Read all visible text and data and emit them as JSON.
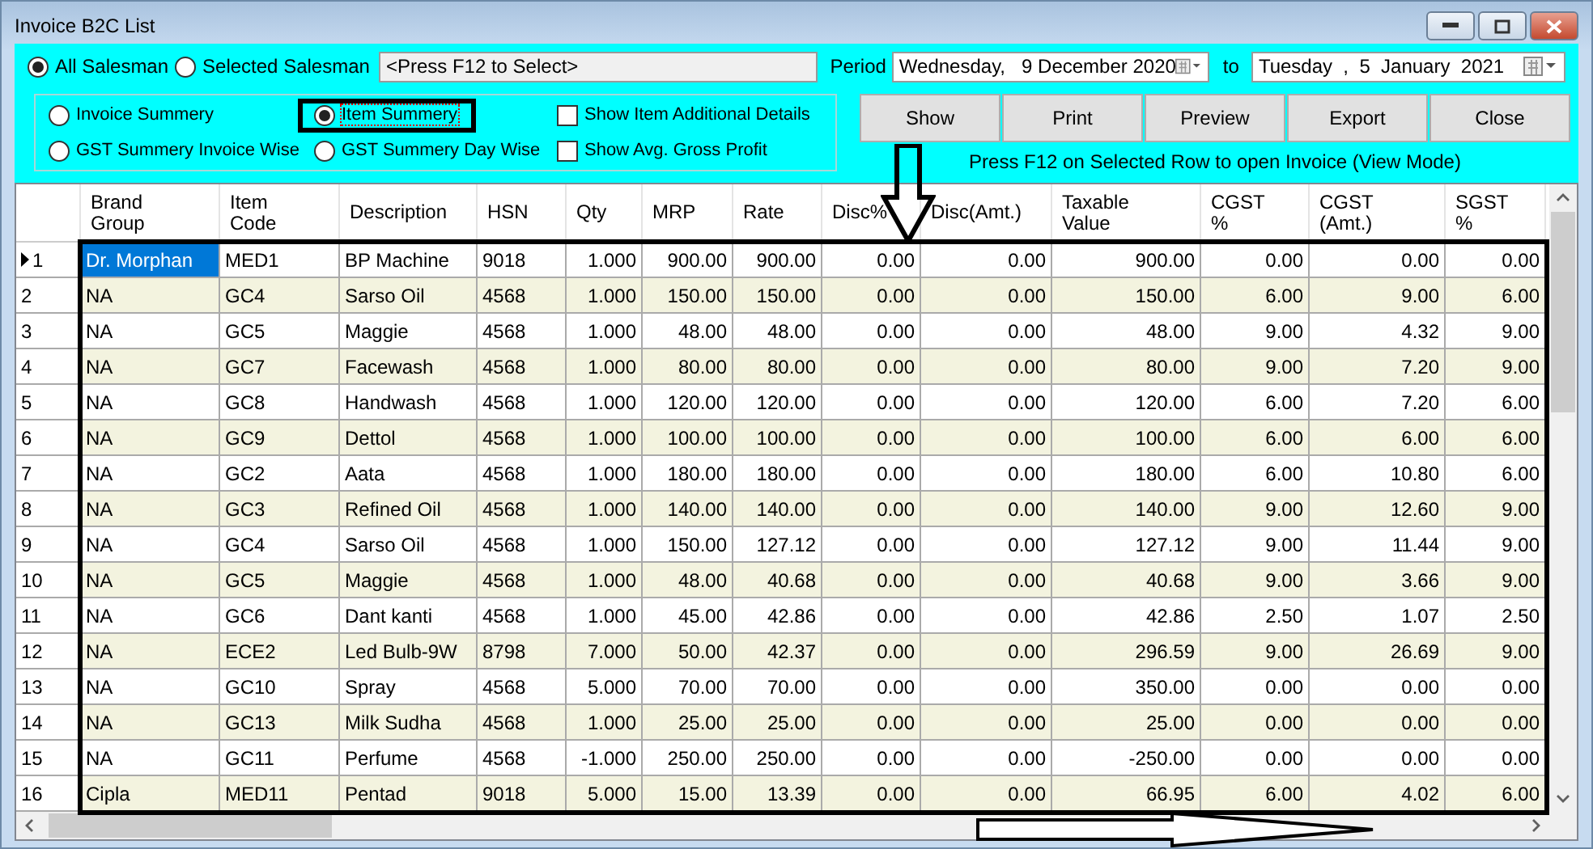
{
  "window": {
    "title": "Invoice B2C List"
  },
  "salesman_filter": [
    {
      "label": "All Salesman",
      "selected": true
    },
    {
      "label": "Selected Salesman",
      "selected": false
    }
  ],
  "salesman_field": {
    "value": "<Press F12 to Select>"
  },
  "period": {
    "label": "Period",
    "from": "Wednesday,   9 December 2020",
    "to_label": "to",
    "to": "Tuesday  ,  5  January  2021"
  },
  "report_types": [
    {
      "label": "Invoice Summery",
      "selected": false,
      "highlighted": false
    },
    {
      "label": "Item Summery",
      "selected": true,
      "highlighted": true
    },
    {
      "label": "GST Summery Invoice Wise",
      "selected": false,
      "highlighted": false
    },
    {
      "label": "GST Summery Day Wise",
      "selected": false,
      "highlighted": false
    }
  ],
  "options": [
    {
      "label": "Show Item Additional Details",
      "checked": false
    },
    {
      "label": "Show Avg. Gross Profit",
      "checked": false
    }
  ],
  "buttons": [
    "Show",
    "Print",
    "Preview",
    "Export",
    "Close"
  ],
  "hint": "Press F12 on Selected Row to open Invoice (View Mode)",
  "table": {
    "columns": [
      "Brand\nGroup",
      "Item\nCode",
      "Description",
      "HSN",
      "Qty",
      "MRP",
      "Rate",
      "Disc%",
      "Disc(Amt.)",
      "Taxable\nValue",
      "CGST\n%",
      "CGST\n(Amt.)",
      "SGST\n%"
    ],
    "rows": [
      {
        "number": "1",
        "selected": true,
        "cells": [
          "Dr. Morphan",
          "MED1",
          "BP Machine",
          "9018",
          "1.000",
          "900.00",
          "900.00",
          "0.00",
          "0.00",
          "900.00",
          "0.00",
          "0.00",
          "0.00"
        ]
      },
      {
        "number": "2",
        "selected": false,
        "cells": [
          "NA",
          "GC4",
          "Sarso Oil",
          "4568",
          "1.000",
          "150.00",
          "150.00",
          "0.00",
          "0.00",
          "150.00",
          "6.00",
          "9.00",
          "6.00"
        ]
      },
      {
        "number": "3",
        "selected": false,
        "cells": [
          "NA",
          "GC5",
          "Maggie",
          "4568",
          "1.000",
          "48.00",
          "48.00",
          "0.00",
          "0.00",
          "48.00",
          "9.00",
          "4.32",
          "9.00"
        ]
      },
      {
        "number": "4",
        "selected": false,
        "cells": [
          "NA",
          "GC7",
          "Facewash",
          "4568",
          "1.000",
          "80.00",
          "80.00",
          "0.00",
          "0.00",
          "80.00",
          "9.00",
          "7.20",
          "9.00"
        ]
      },
      {
        "number": "5",
        "selected": false,
        "cells": [
          "NA",
          "GC8",
          "Handwash",
          "4568",
          "1.000",
          "120.00",
          "120.00",
          "0.00",
          "0.00",
          "120.00",
          "6.00",
          "7.20",
          "6.00"
        ]
      },
      {
        "number": "6",
        "selected": false,
        "cells": [
          "NA",
          "GC9",
          "Dettol",
          "4568",
          "1.000",
          "100.00",
          "100.00",
          "0.00",
          "0.00",
          "100.00",
          "6.00",
          "6.00",
          "6.00"
        ]
      },
      {
        "number": "7",
        "selected": false,
        "cells": [
          "NA",
          "GC2",
          "Aata",
          "4568",
          "1.000",
          "180.00",
          "180.00",
          "0.00",
          "0.00",
          "180.00",
          "6.00",
          "10.80",
          "6.00"
        ]
      },
      {
        "number": "8",
        "selected": false,
        "cells": [
          "NA",
          "GC3",
          "Refined Oil",
          "4568",
          "1.000",
          "140.00",
          "140.00",
          "0.00",
          "0.00",
          "140.00",
          "9.00",
          "12.60",
          "9.00"
        ]
      },
      {
        "number": "9",
        "selected": false,
        "cells": [
          "NA",
          "GC4",
          "Sarso Oil",
          "4568",
          "1.000",
          "150.00",
          "127.12",
          "0.00",
          "0.00",
          "127.12",
          "9.00",
          "11.44",
          "9.00"
        ]
      },
      {
        "number": "10",
        "selected": false,
        "cells": [
          "NA",
          "GC5",
          "Maggie",
          "4568",
          "1.000",
          "48.00",
          "40.68",
          "0.00",
          "0.00",
          "40.68",
          "9.00",
          "3.66",
          "9.00"
        ]
      },
      {
        "number": "11",
        "selected": false,
        "cells": [
          "NA",
          "GC6",
          "Dant kanti",
          "4568",
          "1.000",
          "45.00",
          "42.86",
          "0.00",
          "0.00",
          "42.86",
          "2.50",
          "1.07",
          "2.50"
        ]
      },
      {
        "number": "12",
        "selected": false,
        "cells": [
          "NA",
          "ECE2",
          "Led Bulb-9W",
          "8798",
          "7.000",
          "50.00",
          "42.37",
          "0.00",
          "0.00",
          "296.59",
          "9.00",
          "26.69",
          "9.00"
        ]
      },
      {
        "number": "13",
        "selected": false,
        "cells": [
          "NA",
          "GC10",
          "Spray",
          "4568",
          "5.000",
          "70.00",
          "70.00",
          "0.00",
          "0.00",
          "350.00",
          "0.00",
          "0.00",
          "0.00"
        ]
      },
      {
        "number": "14",
        "selected": false,
        "cells": [
          "NA",
          "GC13",
          "Milk Sudha",
          "4568",
          "1.000",
          "25.00",
          "25.00",
          "0.00",
          "0.00",
          "25.00",
          "0.00",
          "0.00",
          "0.00"
        ]
      },
      {
        "number": "15",
        "selected": false,
        "cells": [
          "NA",
          "GC11",
          "Perfume",
          "4568",
          "-1.000",
          "250.00",
          "250.00",
          "0.00",
          "0.00",
          "-250.00",
          "0.00",
          "0.00",
          "0.00"
        ]
      },
      {
        "number": "16",
        "selected": false,
        "cells": [
          "Cipla",
          "MED11",
          "Pentad",
          "9018",
          "5.000",
          "15.00",
          "13.39",
          "0.00",
          "0.00",
          "66.95",
          "6.00",
          "4.02",
          "6.00"
        ]
      }
    ]
  }
}
